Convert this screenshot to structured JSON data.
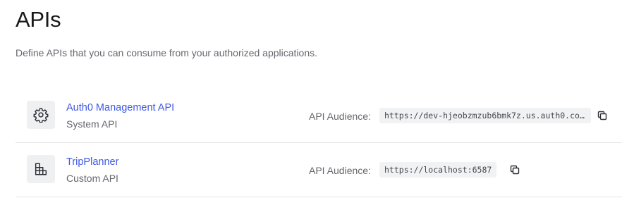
{
  "page": {
    "title": "APIs",
    "description": "Define APIs that you can consume from your authorized applications."
  },
  "apis": [
    {
      "name": "Auth0 Management API",
      "type": "System API",
      "icon": "gear-icon",
      "audience_label": "API Audience:",
      "audience": "https://dev-hjeobzmzub6bmk7z.us.auth0.com/api/v2/",
      "copy_icon": "copy-icon"
    },
    {
      "name": "TripPlanner",
      "type": "Custom API",
      "icon": "building-blocks-icon",
      "audience_label": "API Audience:",
      "audience": "https://localhost:6587",
      "copy_icon": "copy-icon"
    }
  ],
  "colors": {
    "link": "#3f59e4",
    "muted_text": "#65676e",
    "icon_bg": "#eff0f2",
    "divider": "#e3e4e6"
  }
}
